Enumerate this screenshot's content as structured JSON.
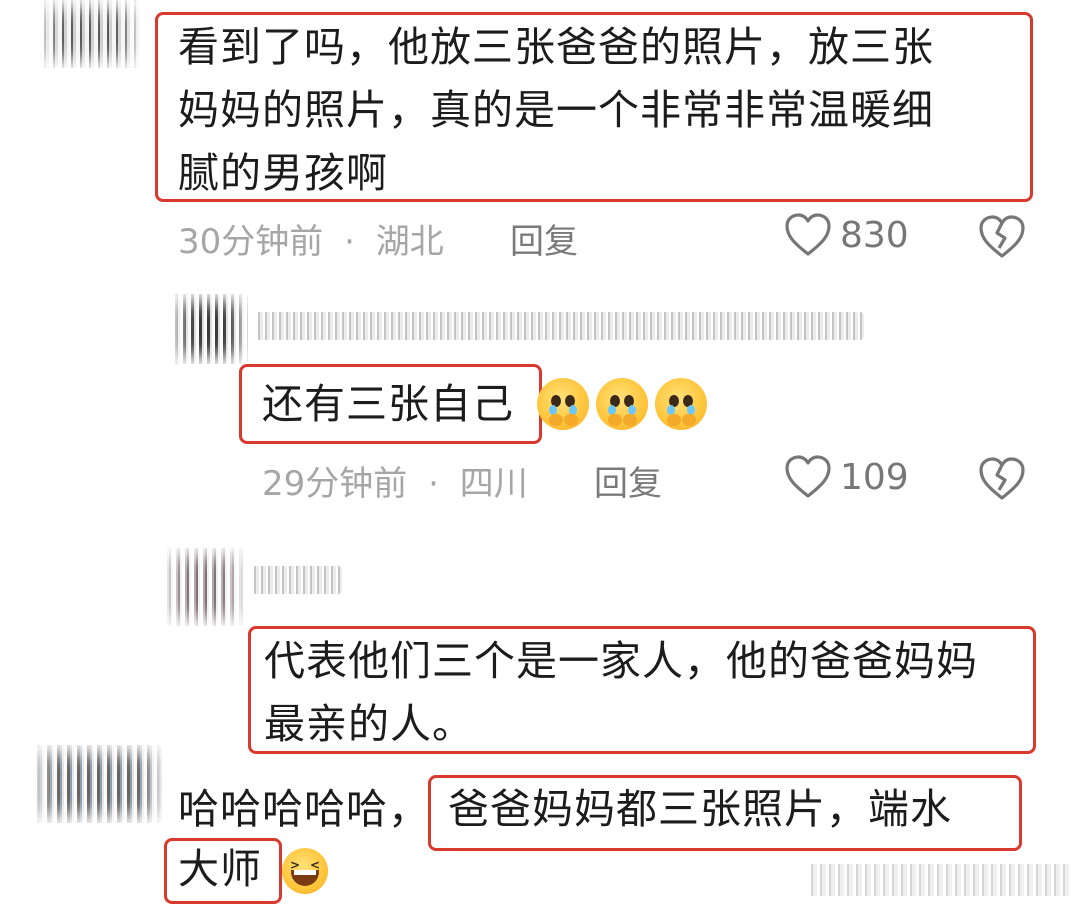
{
  "comment1": {
    "text_lines": [
      "看到了吗，他放三张爸爸的照片，放三张",
      "妈妈的照片，真的是一个非常非常温暖细",
      "腻的男孩啊"
    ],
    "time": "30分钟前",
    "location": "湖北",
    "reply_label": "回复",
    "likes": "830"
  },
  "reply1": {
    "text": "还有三张自己",
    "emojis": [
      "pleading-crying-emoji",
      "pleading-crying-emoji",
      "pleading-crying-emoji"
    ],
    "time": "29分钟前",
    "location": "四川",
    "reply_label": "回复",
    "likes": "109"
  },
  "comment2": {
    "text_lines": [
      "代表他们三个是一家人，他的爸爸妈妈",
      "最亲的人。"
    ]
  },
  "comment3": {
    "prefix": "哈哈哈哈哈，",
    "boxed_part1": "爸爸妈妈都三张照片，端水",
    "boxed_part2": "大师",
    "emoji": "laughing-emoji"
  },
  "separator": "·",
  "colors": {
    "highlight_box": "#d83a2e",
    "meta_gray": "#a6a6a6",
    "text": "#1c1c1c"
  }
}
